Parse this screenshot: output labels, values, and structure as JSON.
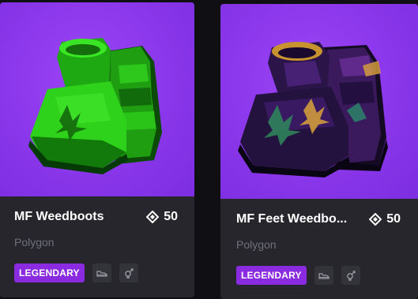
{
  "items": [
    {
      "name": "MF Weedboots",
      "price": "50",
      "creator": "Polygon",
      "rarity": "LEGENDARY",
      "category_icon": "shoe-icon",
      "gender_icon": "unisex-gender-icon",
      "colors": {
        "primary": "#2fd21a",
        "dark": "#0f5a0a",
        "background": "#8a36ea"
      }
    },
    {
      "name": "MF Feet Weedbo...",
      "price": "50",
      "creator": "Polygon",
      "rarity": "LEGENDARY",
      "category_icon": "shoe-icon",
      "gender_icon": "unisex-gender-icon",
      "colors": {
        "primary": "#3a1a5a",
        "accent": "#d9a23a",
        "background": "#8a36ea"
      }
    }
  ],
  "colors": {
    "card_bg": "#26262c",
    "page_bg": "#101014",
    "legendary": "#8a2be2",
    "muted_text": "#70707a"
  }
}
